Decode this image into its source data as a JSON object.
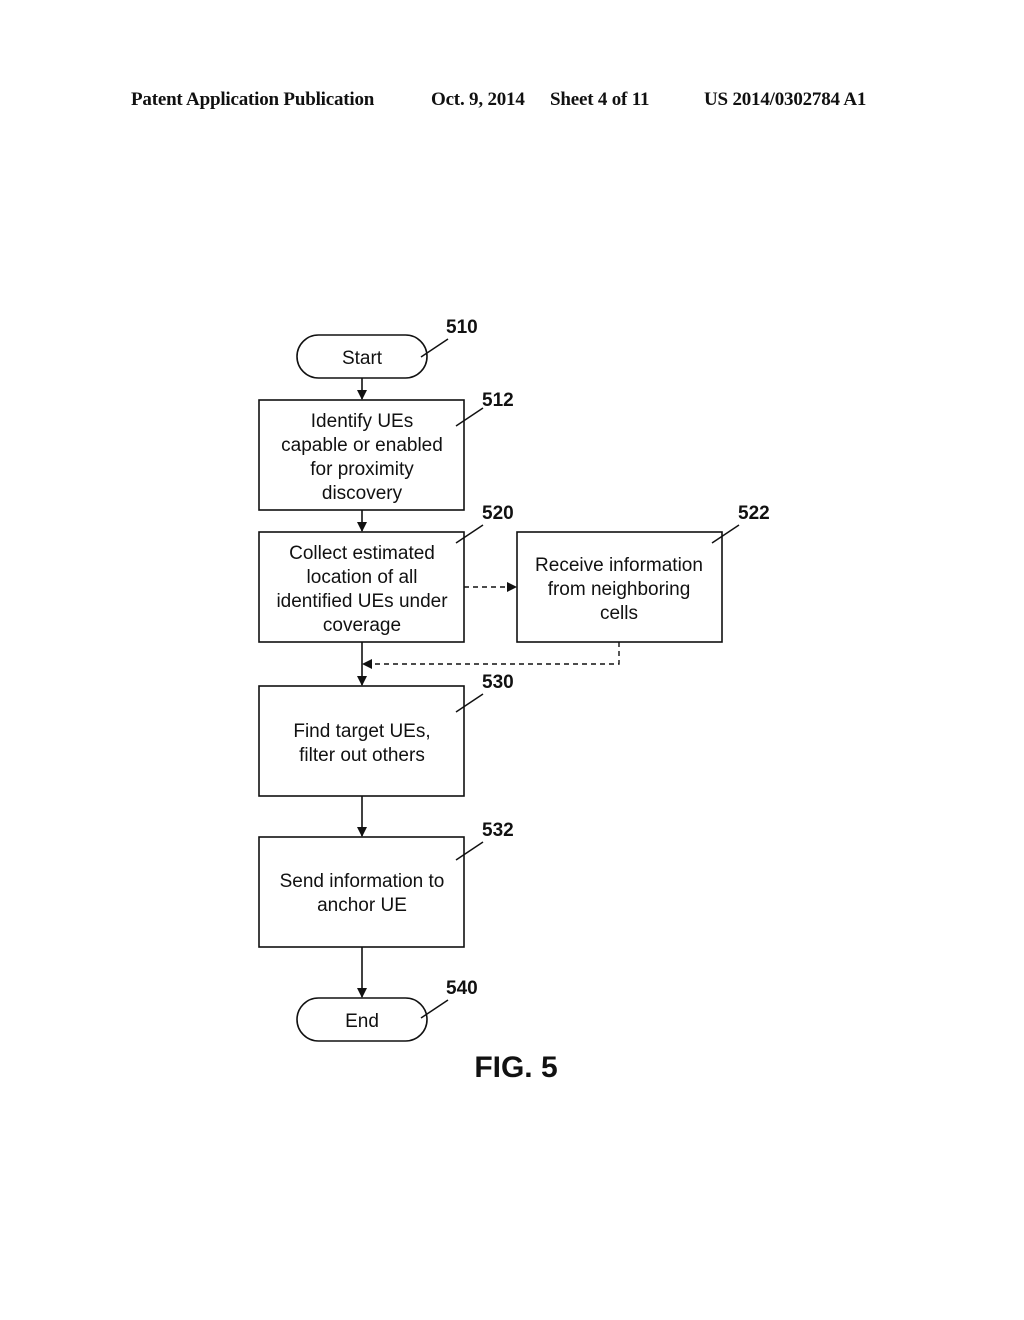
{
  "header": {
    "publication": "Patent Application Publication",
    "date": "Oct. 9, 2014",
    "sheet": "Sheet 4 of 11",
    "number": "US 2014/0302784 A1"
  },
  "figure_label": "FIG. 5",
  "nodes": {
    "start": {
      "ref": "510",
      "lines": [
        "Start"
      ]
    },
    "identify": {
      "ref": "512",
      "lines": [
        "Identify UEs",
        "capable or enabled",
        "for proximity",
        "discovery"
      ]
    },
    "collect": {
      "ref": "520",
      "lines": [
        "Collect estimated",
        "location of all",
        "identified UEs under",
        "coverage"
      ]
    },
    "receive": {
      "ref": "522",
      "lines": [
        "Receive information",
        "from neighboring",
        "cells"
      ]
    },
    "find": {
      "ref": "530",
      "lines": [
        "Find target UEs,",
        "filter out others"
      ]
    },
    "send": {
      "ref": "532",
      "lines": [
        "Send information to",
        "anchor UE"
      ]
    },
    "end": {
      "ref": "540",
      "lines": [
        "End"
      ]
    }
  },
  "edges": [
    {
      "from": "510",
      "to": "512",
      "style": "solid"
    },
    {
      "from": "512",
      "to": "520",
      "style": "solid"
    },
    {
      "from": "520",
      "to": "522",
      "style": "dashed"
    },
    {
      "from": "522",
      "to": "530",
      "style": "dashed"
    },
    {
      "from": "520",
      "to": "530",
      "style": "solid"
    },
    {
      "from": "530",
      "to": "532",
      "style": "solid"
    },
    {
      "from": "532",
      "to": "540",
      "style": "solid"
    }
  ]
}
